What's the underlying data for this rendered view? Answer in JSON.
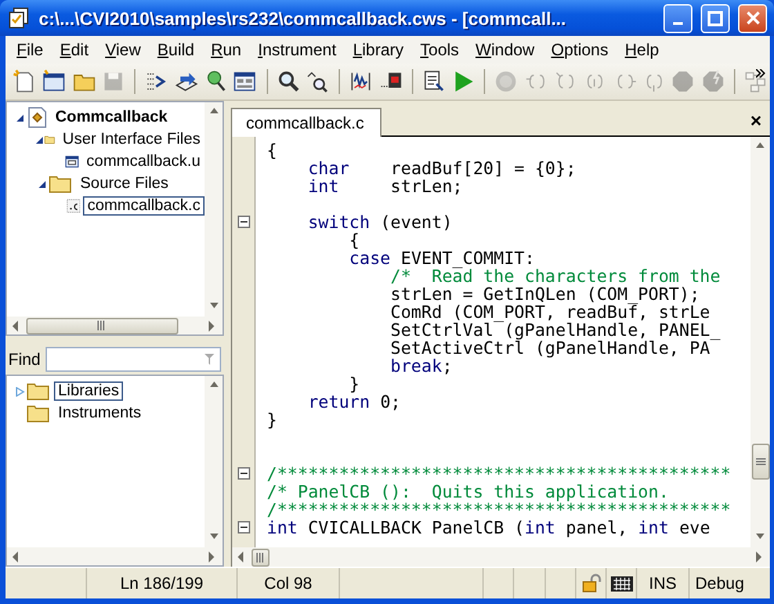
{
  "window": {
    "title": "c:\\...\\CVI2010\\samples\\rs232\\commcallback.cws - [commcall..."
  },
  "menu": [
    "File",
    "Edit",
    "View",
    "Build",
    "Run",
    "Instrument",
    "Library",
    "Tools",
    "Window",
    "Options",
    "Help"
  ],
  "toolbar": [
    {
      "kind": "button",
      "disabled": false
    },
    {
      "kind": "button",
      "disabled": false
    },
    {
      "kind": "button",
      "disabled": false
    },
    {
      "kind": "button",
      "disabled": true
    },
    {
      "kind": "separator"
    },
    {
      "kind": "button",
      "disabled": false
    },
    {
      "kind": "button",
      "disabled": false
    },
    {
      "kind": "button",
      "disabled": false
    },
    {
      "kind": "button",
      "disabled": false
    },
    {
      "kind": "separator"
    },
    {
      "kind": "button",
      "disabled": false
    },
    {
      "kind": "button",
      "disabled": false
    },
    {
      "kind": "separator"
    },
    {
      "kind": "button",
      "disabled": false
    },
    {
      "kind": "button",
      "disabled": false
    },
    {
      "kind": "separator"
    },
    {
      "kind": "button",
      "disabled": false
    },
    {
      "kind": "button",
      "disabled": false
    },
    {
      "kind": "separator"
    },
    {
      "kind": "button",
      "disabled": true
    },
    {
      "kind": "button",
      "disabled": true
    },
    {
      "kind": "button",
      "disabled": true
    },
    {
      "kind": "button",
      "disabled": true
    },
    {
      "kind": "button",
      "disabled": true
    },
    {
      "kind": "button",
      "disabled": true
    },
    {
      "kind": "button",
      "disabled": true
    },
    {
      "kind": "button",
      "disabled": true
    },
    {
      "kind": "separator"
    },
    {
      "kind": "button",
      "disabled": true
    }
  ],
  "project_tree": [
    {
      "label": "Commcallback",
      "kind": "project",
      "expanded": true,
      "selected": false,
      "children": [
        {
          "label": "User Interface Files",
          "kind": "folder",
          "expanded": true,
          "selected": false,
          "children": [
            {
              "label": "commcallback.u",
              "kind": "uir",
              "selected": false
            }
          ]
        },
        {
          "label": "Source Files",
          "kind": "folder",
          "expanded": true,
          "selected": false,
          "children": [
            {
              "label": "commcallback.c",
              "kind": "source",
              "selected": true
            }
          ]
        }
      ]
    }
  ],
  "find": {
    "label": "Find"
  },
  "library_tree": [
    {
      "label": "Libraries",
      "kind": "folder",
      "expanded": false,
      "selected": true
    },
    {
      "label": "Instruments",
      "kind": "folder",
      "selected": false
    }
  ],
  "editor_tab": {
    "label": "commcallback.c",
    "close": "×"
  },
  "code": [
    {
      "fold": false,
      "segments": [
        {
          "text": "{",
          "kind": "plain"
        }
      ]
    },
    {
      "fold": false,
      "segments": [
        {
          "text": "    char",
          "kind": "keyword"
        },
        {
          "text": "    readBuf[20] = {0};",
          "kind": "plain"
        }
      ]
    },
    {
      "fold": false,
      "segments": [
        {
          "text": "    int",
          "kind": "keyword"
        },
        {
          "text": "     strLen;",
          "kind": "plain"
        }
      ]
    },
    {
      "fold": false
    },
    {
      "fold": true,
      "segments": [
        {
          "text": "    switch",
          "kind": "keyword"
        },
        {
          "text": " (event)",
          "kind": "plain"
        }
      ]
    },
    {
      "fold": false,
      "segments": [
        {
          "text": "        {",
          "kind": "plain"
        }
      ]
    },
    {
      "fold": false,
      "segments": [
        {
          "text": "        case",
          "kind": "keyword"
        },
        {
          "text": " EVENT_COMMIT:",
          "kind": "plain"
        }
      ]
    },
    {
      "fold": false,
      "segments": [
        {
          "text": "            /*  Read the characters from the",
          "kind": "comment"
        }
      ]
    },
    {
      "fold": false,
      "segments": [
        {
          "text": "            strLen = GetInQLen (COM_PORT);",
          "kind": "plain"
        }
      ]
    },
    {
      "fold": false,
      "segments": [
        {
          "text": "            ComRd (COM_PORT, readBuf, strLe",
          "kind": "plain"
        }
      ]
    },
    {
      "fold": false,
      "segments": [
        {
          "text": "            SetCtrlVal (gPanelHandle, PANEL_",
          "kind": "plain"
        }
      ]
    },
    {
      "fold": false,
      "segments": [
        {
          "text": "            SetActiveCtrl (gPanelHandle, PA",
          "kind": "plain"
        }
      ]
    },
    {
      "fold": false,
      "segments": [
        {
          "text": "            break",
          "kind": "keyword"
        },
        {
          "text": ";",
          "kind": "plain"
        }
      ]
    },
    {
      "fold": false,
      "segments": [
        {
          "text": "        }",
          "kind": "plain"
        }
      ]
    },
    {
      "fold": false,
      "segments": [
        {
          "text": "    return",
          "kind": "keyword"
        },
        {
          "text": " 0;",
          "kind": "plain"
        }
      ]
    },
    {
      "fold": false,
      "segments": [
        {
          "text": "}",
          "kind": "plain"
        }
      ]
    },
    {
      "fold": false
    },
    {
      "fold": false
    },
    {
      "fold": true,
      "segments": [
        {
          "text": "/********************************************",
          "kind": "comment"
        }
      ]
    },
    {
      "fold": false,
      "segments": [
        {
          "text": "/* PanelCB ():  Quits this application.",
          "kind": "comment"
        }
      ]
    },
    {
      "fold": false,
      "segments": [
        {
          "text": "/********************************************",
          "kind": "comment"
        }
      ]
    },
    {
      "fold": true,
      "segments": [
        {
          "text": "int",
          "kind": "keyword"
        },
        {
          "text": " CVICALLBACK PanelCB (",
          "kind": "plain"
        },
        {
          "text": "int",
          "kind": "keyword"
        },
        {
          "text": " panel, ",
          "kind": "plain"
        },
        {
          "text": "int",
          "kind": "keyword"
        },
        {
          "text": " eve",
          "kind": "plain"
        }
      ]
    }
  ],
  "status_bar": {
    "line": "Ln 186/199",
    "column": "Col 98",
    "mode": "INS",
    "configuration": "Debug"
  }
}
